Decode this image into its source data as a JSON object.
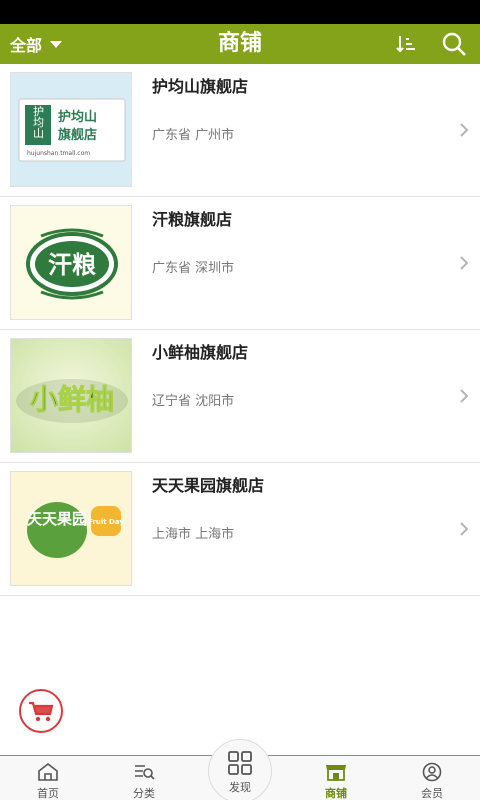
{
  "header": {
    "filter_label": "全部",
    "title": "商铺"
  },
  "shops": [
    {
      "name": "护均山旗舰店",
      "location": "广东省 广州市",
      "logo_lines": [
        "护均山",
        "旗舰店"
      ],
      "logo_side": "护均山",
      "logo_url_text": "hujunshan.tmall.com"
    },
    {
      "name": "汗粮旗舰店",
      "location": "广东省 深圳市",
      "logo_text": "汗粮"
    },
    {
      "name": "小鲜柚旗舰店",
      "location": "辽宁省 沈阳市",
      "logo_text": "小鲜柚"
    },
    {
      "name": "天天果园旗舰店",
      "location": "上海市 上海市",
      "logo_main": "天天果园",
      "logo_badge": "Fruit Day"
    }
  ],
  "tabs": [
    {
      "label": "首页",
      "icon": "home-icon"
    },
    {
      "label": "分类",
      "icon": "category-icon"
    },
    {
      "label": "发现",
      "icon": "discover-icon"
    },
    {
      "label": "商铺",
      "icon": "shop-icon"
    },
    {
      "label": "会员",
      "icon": "member-icon"
    }
  ],
  "colors": {
    "brand": "#84a21a",
    "active_tab": "#6f8a14",
    "cart": "#d63b3b"
  }
}
